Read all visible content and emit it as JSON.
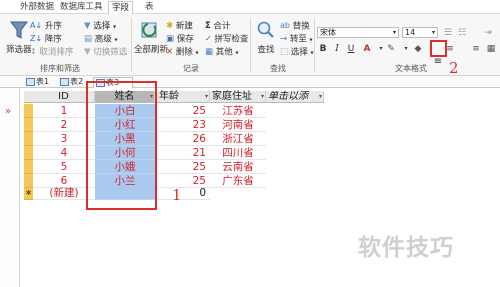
{
  "ribbon_tabs": [
    "外部数据",
    "数据库工具",
    "字段",
    "表"
  ],
  "groups": {
    "sort_filter": {
      "title": "排序和筛选",
      "filter_label": "筛选器",
      "asc": "升序",
      "desc": "降序",
      "clear_sort": "取消排序",
      "selection": "选择",
      "advanced": "高级",
      "toggle_filter": "切换筛选"
    },
    "records": {
      "title": "记录",
      "refresh": "全部刷新",
      "new": "新建",
      "save": "保存",
      "delete": "删除",
      "totals": "合计",
      "spelling": "拼写检查",
      "more": "其他"
    },
    "find": {
      "title": "查找",
      "find": "查找",
      "replace": "替换",
      "goto": "转至",
      "select": "选择"
    },
    "text_format": {
      "title": "文本格式",
      "font": "宋体",
      "size": "14",
      "bold": "B",
      "italic": "I",
      "underline": "U"
    }
  },
  "annotations": {
    "box1_label": "1",
    "box2_label": "2"
  },
  "doc_tabs": [
    "表1",
    "表2",
    "表3"
  ],
  "columns": [
    "ID",
    "姓名",
    "年龄",
    "家庭住址",
    "单击以添"
  ],
  "rows": [
    {
      "id": "1",
      "name": "小白",
      "age": "25",
      "addr": "江苏省"
    },
    {
      "id": "2",
      "name": "小红",
      "age": "23",
      "addr": "河南省"
    },
    {
      "id": "3",
      "name": "小黑",
      "age": "26",
      "addr": "浙江省"
    },
    {
      "id": "4",
      "name": "小何",
      "age": "21",
      "addr": "四川省"
    },
    {
      "id": "5",
      "name": "小娥",
      "age": "25",
      "addr": "云南省"
    },
    {
      "id": "6",
      "name": "小兰",
      "age": "25",
      "addr": "广东省"
    }
  ],
  "new_row": {
    "id": "(新建)",
    "age": "0"
  },
  "watermark": "软件技巧",
  "colors": {
    "highlight_red": "#d9302a",
    "selected_column": "#a9c9ee",
    "record_selector": "#f2c75c"
  }
}
